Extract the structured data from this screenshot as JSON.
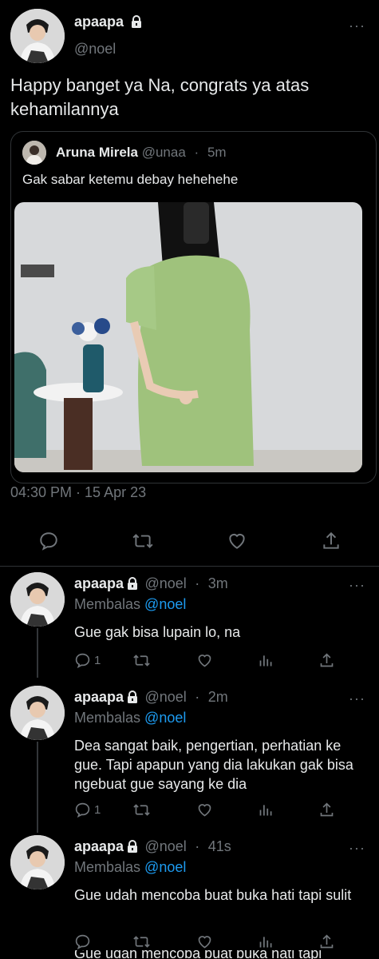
{
  "main_tweet": {
    "name": "apaapa",
    "handle": "@noel",
    "text": "Happy banget ya Na, congrats ya atas kehamilannya",
    "timestamp": "04:30 PM · 15 Apr 23",
    "more": "···",
    "quote": {
      "name": "Aruna Mirela",
      "handle": "@unaa",
      "separator": "·",
      "time": "5m",
      "text": "Gak sabar ketemu debay hehehehe"
    }
  },
  "replies": [
    {
      "name": "apaapa",
      "handle": "@noel",
      "separator": "·",
      "time": "3m",
      "replying_prefix": "Membalas",
      "replying_to": "@noel",
      "text": "Gue gak bisa lupain lo, na",
      "reply_count": "1",
      "more": "···"
    },
    {
      "name": "apaapa",
      "handle": "@noel",
      "separator": "·",
      "time": "2m",
      "replying_prefix": "Membalas",
      "replying_to": "@noel",
      "text": "Dea sangat baik, pengertian, perhatian ke gue. Tapi apapun yang dia lakukan gak bisa ngebuat gue sayang ke dia",
      "reply_count": "1",
      "more": "···"
    },
    {
      "name": "apaapa",
      "handle": "@noel",
      "separator": "·",
      "time": "41s",
      "replying_prefix": "Membalas",
      "replying_to": "@noel",
      "text": "Gue udah mencoba buat buka hati tapi sulit",
      "reply_count": "",
      "more": "···"
    }
  ],
  "cutoff_text": "Gue udah mencoba buat buka hati tapi",
  "colors": {
    "background": "#000000",
    "text": "#e7e9ea",
    "muted": "#71767b",
    "link": "#1d9bf0",
    "divider": "#2f3336"
  },
  "icons": [
    "lock-icon",
    "reply-icon",
    "retweet-icon",
    "like-icon",
    "share-icon",
    "views-icon",
    "more-icon"
  ]
}
